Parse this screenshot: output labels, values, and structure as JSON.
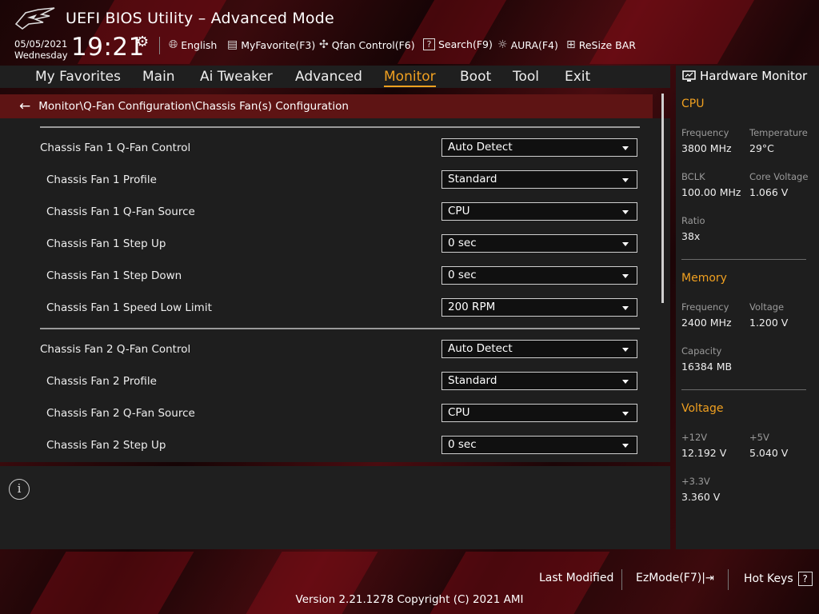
{
  "header": {
    "title": "UEFI BIOS Utility – Advanced Mode",
    "date": "05/05/2021",
    "day": "Wednesday",
    "time": "19:21",
    "tools": [
      {
        "label": "English",
        "icon": "globe-icon"
      },
      {
        "label": "MyFavorite(F3)",
        "icon": "favorite-icon"
      },
      {
        "label": "Qfan Control(F6)",
        "icon": "fan-icon"
      },
      {
        "label": "Search(F9)",
        "icon": "search-help-icon"
      },
      {
        "label": "AURA(F4)",
        "icon": "aura-light-icon"
      },
      {
        "label": "ReSize BAR",
        "icon": "resize-bar-icon"
      }
    ]
  },
  "nav": {
    "items": [
      "My Favorites",
      "Main",
      "Ai Tweaker",
      "Advanced",
      "Monitor",
      "Boot",
      "Tool",
      "Exit"
    ],
    "active": "Monitor"
  },
  "breadcrumb": "Monitor\\Q-Fan Configuration\\Chassis Fan(s) Configuration",
  "settings": [
    {
      "label": "Chassis Fan 1 Q-Fan Control",
      "value": "Auto Detect"
    },
    {
      "label": "Chassis Fan 1 Profile",
      "value": "Standard"
    },
    {
      "label": "Chassis Fan 1 Q-Fan Source",
      "value": "CPU"
    },
    {
      "label": "Chassis Fan 1 Step Up",
      "value": "0 sec"
    },
    {
      "label": "Chassis Fan 1 Step Down",
      "value": "0 sec"
    },
    {
      "label": "Chassis Fan 1 Speed Low Limit",
      "value": "200 RPM"
    },
    {
      "label": "Chassis Fan 2 Q-Fan Control",
      "value": "Auto Detect"
    },
    {
      "label": "Chassis Fan 2 Profile",
      "value": "Standard"
    },
    {
      "label": "Chassis Fan 2 Q-Fan Source",
      "value": "CPU"
    },
    {
      "label": "Chassis Fan 2 Step Up",
      "value": "0 sec"
    }
  ],
  "hardware_monitor": {
    "title": "Hardware Monitor",
    "cpu": {
      "title": "CPU",
      "frequency_label": "Frequency",
      "frequency": "3800 MHz",
      "temperature_label": "Temperature",
      "temperature": "29°C",
      "bclk_label": "BCLK",
      "bclk": "100.00 MHz",
      "core_voltage_label": "Core Voltage",
      "core_voltage": "1.066 V",
      "ratio_label": "Ratio",
      "ratio": "38x"
    },
    "memory": {
      "title": "Memory",
      "frequency_label": "Frequency",
      "frequency": "2400 MHz",
      "voltage_label": "Voltage",
      "voltage": "1.200 V",
      "capacity_label": "Capacity",
      "capacity": "16384 MB"
    },
    "voltage": {
      "title": "Voltage",
      "v12_label": "+12V",
      "v12": "12.192 V",
      "v5_label": "+5V",
      "v5": "5.040 V",
      "v33_label": "+3.3V",
      "v33": "3.360 V"
    }
  },
  "footer": {
    "last_modified": "Last Modified",
    "ezmode": "EzMode(F7)|",
    "hot_keys": "Hot Keys",
    "hot_keys_box": "?",
    "version": "Version 2.21.1278 Copyright (C) 2021 AMI"
  }
}
